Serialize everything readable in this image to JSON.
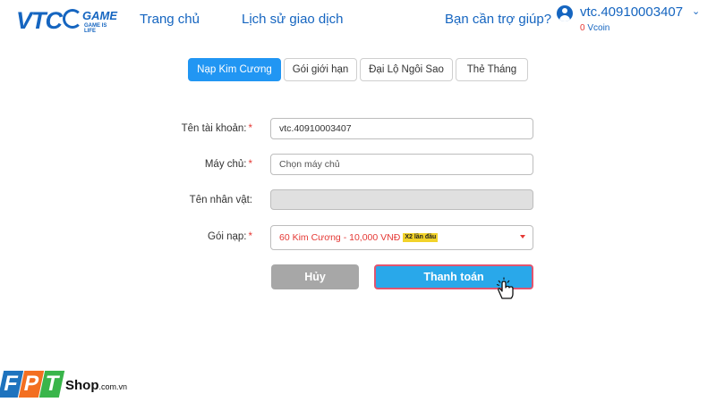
{
  "header": {
    "logo": {
      "main": "VTC",
      "game": "GAME",
      "tagline": "GAME IS LIFE"
    },
    "nav": [
      {
        "label": "Trang chủ"
      },
      {
        "label": "Lịch sử giao dịch"
      },
      {
        "label": "Bạn cần trợ giúp?"
      }
    ],
    "user": {
      "name": "vtc.40910003407",
      "coin_value": "0",
      "coin_unit": "Vcoin"
    }
  },
  "tabs": [
    {
      "label": "Nạp Kim Cương",
      "active": true
    },
    {
      "label": "Gói giới hạn",
      "active": false
    },
    {
      "label": "Đại Lộ Ngôi Sao",
      "active": false
    },
    {
      "label": "Thẻ Tháng",
      "active": false
    }
  ],
  "form": {
    "account": {
      "label": "Tên tài khoản:",
      "required": "*",
      "value": "vtc.40910003407"
    },
    "server": {
      "label": "Máy chủ:",
      "required": "*",
      "placeholder": "Chọn máy chủ"
    },
    "character": {
      "label": "Tên nhân vật:",
      "value": ""
    },
    "package": {
      "label": "Gói nạp:",
      "required": "*",
      "value": "60 Kim Cương - 10,000 VNĐ",
      "badge": "X2 lần đầu"
    }
  },
  "buttons": {
    "cancel": "Hủy",
    "pay": "Thanh toán"
  },
  "watermark": {
    "letters": [
      "F",
      "P",
      "T"
    ],
    "shop": "Shop",
    "domain": ".com.vn"
  },
  "colors": {
    "brand": "#1565c0",
    "accent": "#2196f3",
    "pay": "#29a8ea",
    "error": "#e53935",
    "disabled": "#a7a7a7"
  },
  "icons": {
    "user": "user-circle-icon",
    "chevron": "chevron-down-icon",
    "dropdown": "caret-down-icon",
    "cursor": "hand-pointer-icon"
  }
}
